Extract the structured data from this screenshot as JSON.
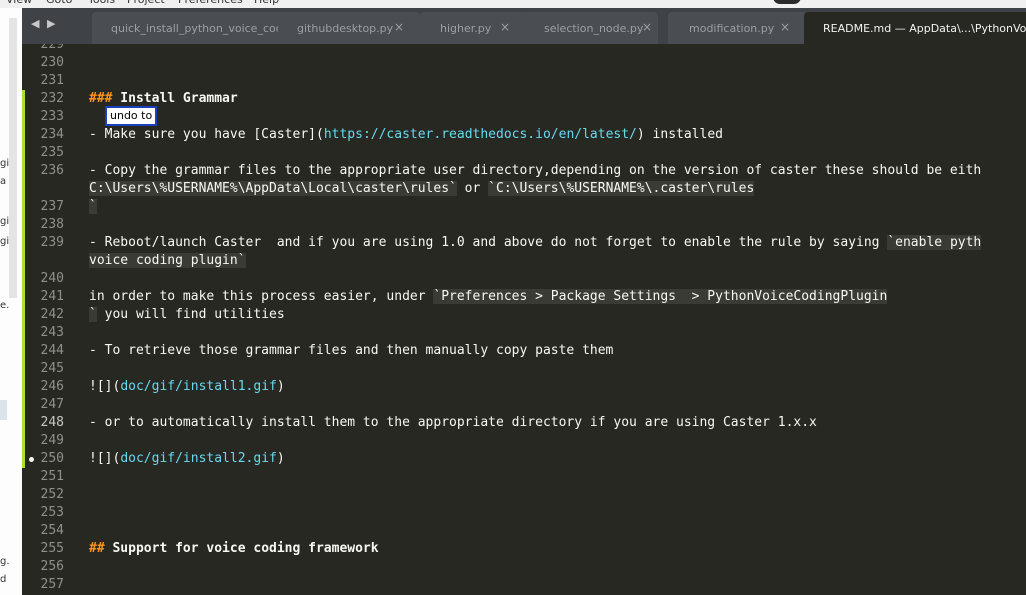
{
  "menu": {
    "items": [
      "View",
      "Goto",
      "Tools",
      "Project",
      "Preferences",
      "Help"
    ]
  },
  "left_pane": {
    "fragments": [
      "gi",
      "a",
      "gi",
      "gi",
      "e.",
      "g.",
      "d"
    ]
  },
  "tabs": [
    {
      "label": "quick_install_python_voice_coding_",
      "close": "",
      "active": false
    },
    {
      "label": "githubdesktop.py",
      "close": "×",
      "active": false
    },
    {
      "label": "higher.py",
      "close": "×",
      "active": false
    },
    {
      "label": "selection_node.py",
      "close": "×",
      "active": false
    },
    {
      "label": "modification.py",
      "close": "×",
      "active": false
    },
    {
      "label": "README.md — AppData\\...\\PythonVoiceC",
      "close": "",
      "active": true
    }
  ],
  "nav_arrows": "◀ ▶",
  "tooltip": "undo to",
  "accent_colors": {
    "header": "#fd971f",
    "url": "#66d9ef",
    "gutter_mark": "#a6e22e",
    "background": "#272822"
  },
  "editor": {
    "lines": [
      {
        "n": "229",
        "parts": []
      },
      {
        "n": "230",
        "parts": []
      },
      {
        "n": "231",
        "parts": []
      },
      {
        "n": "232",
        "parts": [
          {
            "t": "###",
            "c": "hdr bold"
          },
          {
            "t": " Install Grammar",
            "c": "bold"
          }
        ]
      },
      {
        "n": "233",
        "parts": []
      },
      {
        "n": "234",
        "parts": [
          {
            "t": "- Make sure you have [Caster](",
            "c": ""
          },
          {
            "t": "https://caster.readthedocs.io/en/latest/",
            "c": "url"
          },
          {
            "t": ") installed",
            "c": ""
          }
        ]
      },
      {
        "n": "235",
        "parts": []
      },
      {
        "n": "236",
        "parts": [
          {
            "t": "- Copy the grammar files to the appropriate user directory,depending on the version of caster these should be eith",
            "c": ""
          }
        ]
      },
      {
        "n": "",
        "parts": [
          {
            "t": "C:\\Users\\%USERNAME%\\AppData\\Local\\caster\\rules`",
            "c": "codespan"
          },
          {
            "t": " or ",
            "c": ""
          },
          {
            "t": "`C:\\Users\\%USERNAME%\\.caster\\rules",
            "c": "codespan"
          }
        ]
      },
      {
        "n": "237",
        "parts": [
          {
            "t": "`",
            "c": "codespan"
          }
        ]
      },
      {
        "n": "238",
        "parts": []
      },
      {
        "n": "239",
        "parts": [
          {
            "t": "- Reboot/launch Caster  and if you are using 1.0 and above do not forget to enable the rule by saying ",
            "c": ""
          },
          {
            "t": "`enable pyth",
            "c": "codespan"
          }
        ]
      },
      {
        "n": "",
        "parts": [
          {
            "t": "voice coding plugin`",
            "c": "codespan"
          }
        ]
      },
      {
        "n": "240",
        "parts": []
      },
      {
        "n": "241",
        "parts": [
          {
            "t": "in order to make this process easier, under ",
            "c": ""
          },
          {
            "t": "`Preferences > Package Settings  > PythonVoiceCodingPlugin",
            "c": "codespan"
          }
        ]
      },
      {
        "n": "242",
        "parts": [
          {
            "t": "`",
            "c": "codespan"
          },
          {
            "t": " you will find utilities",
            "c": ""
          }
        ]
      },
      {
        "n": "243",
        "parts": []
      },
      {
        "n": "244",
        "parts": [
          {
            "t": "- To retrieve those grammar files and then manually copy paste them",
            "c": ""
          }
        ]
      },
      {
        "n": "245",
        "parts": []
      },
      {
        "n": "246",
        "parts": [
          {
            "t": "![](",
            "c": ""
          },
          {
            "t": "doc/gif/install1.gif",
            "c": "url"
          },
          {
            "t": ")",
            "c": ""
          }
        ]
      },
      {
        "n": "247",
        "parts": []
      },
      {
        "n": "248",
        "parts": [
          {
            "t": "- or to automatically install them to the appropriate directory if you are using Caster 1.x.x",
            "c": ""
          }
        ]
      },
      {
        "n": "249",
        "parts": []
      },
      {
        "n": "250",
        "parts": [
          {
            "t": "![](",
            "c": ""
          },
          {
            "t": "doc/gif/install2.gif",
            "c": "url"
          },
          {
            "t": ")",
            "c": ""
          }
        ]
      },
      {
        "n": "251",
        "parts": []
      },
      {
        "n": "252",
        "parts": []
      },
      {
        "n": "253",
        "parts": []
      },
      {
        "n": "254",
        "parts": []
      },
      {
        "n": "255",
        "parts": [
          {
            "t": "##",
            "c": "hdr bold"
          },
          {
            "t": " Support for voice coding framework",
            "c": "bold"
          }
        ]
      },
      {
        "n": "256",
        "parts": []
      },
      {
        "n": "257",
        "parts": []
      }
    ]
  }
}
